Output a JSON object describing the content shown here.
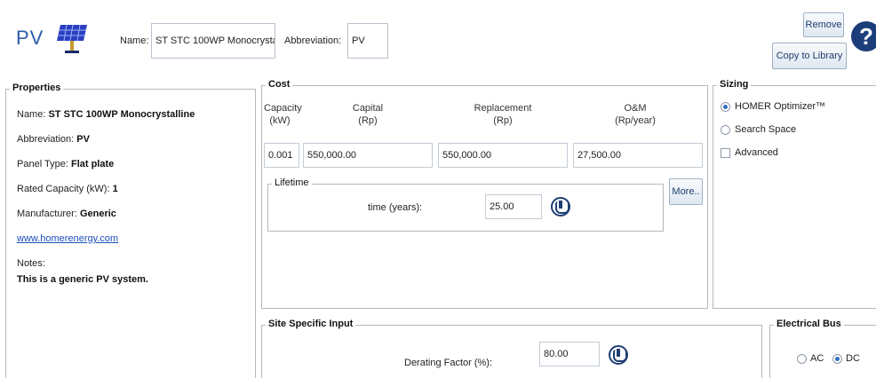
{
  "header": {
    "title": "PV",
    "name_label": "Name:",
    "name_value": "ST STC 100WP Monocrysta",
    "abbreviation_label": "Abbreviation:",
    "abbreviation_value": "PV",
    "remove_label": "Remove",
    "copy_library_label": "Copy to Library",
    "help_label": "?"
  },
  "properties": {
    "title": "Properties",
    "name_key": "Name:",
    "name_val": "ST STC 100WP Monocrystalline",
    "abbrev_key": "Abbreviation:",
    "abbrev_val": "PV",
    "panel_type_key": "Panel Type:",
    "panel_type_val": "Flat plate",
    "rated_capacity_key": "Rated Capacity (kW):",
    "rated_capacity_val": "1",
    "manufacturer_key": "Manufacturer:",
    "manufacturer_val": "Generic",
    "website": "www.homerenergy.com",
    "notes_key": "Notes:",
    "notes_val": "This is a generic PV system."
  },
  "cost": {
    "title": "Cost",
    "columns": [
      {
        "line1": "Capacity",
        "line2": "(kW)"
      },
      {
        "line1": "Capital",
        "line2": "(Rp)"
      },
      {
        "line1": "Replacement",
        "line2": "(Rp)"
      },
      {
        "line1": "O&M",
        "line2": "(Rp/year)"
      }
    ],
    "row": {
      "capacity": "0.001",
      "capital": "550,000.00",
      "replacement": "550,000.00",
      "om": "27,500.00"
    },
    "more_label": "More..",
    "lifetime": {
      "title": "Lifetime",
      "time_label": "time (years):",
      "time_value": "25.00"
    }
  },
  "sizing": {
    "title": "Sizing",
    "options": [
      {
        "label": "HOMER Optimizer™",
        "selected": true
      },
      {
        "label": "Search Space",
        "selected": false
      }
    ],
    "advanced_label": "Advanced"
  },
  "site": {
    "title": "Site Specific Input",
    "derating_label": "Derating Factor (%):",
    "derating_value": "80.00"
  },
  "bus": {
    "title": "Electrical Bus",
    "ac_label": "AC",
    "dc_label": "DC",
    "selected": "DC"
  },
  "colors": {
    "accent": "#2a5ca8",
    "help_bg": "#1b3e7a",
    "link": "#1a4fb8"
  }
}
